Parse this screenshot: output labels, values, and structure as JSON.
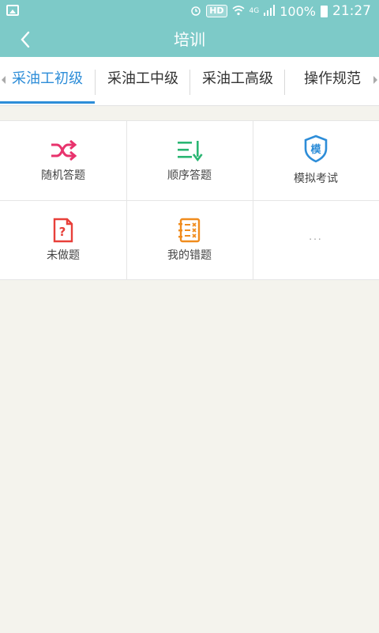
{
  "status_bar": {
    "network_badge": "HD",
    "network_type": "4G",
    "battery": "100%",
    "time": "21:27"
  },
  "header": {
    "title": "培训",
    "back_icon": "chevron-left-icon"
  },
  "tabs": [
    {
      "label": "采油工初级",
      "active": true
    },
    {
      "label": "采油工中级",
      "active": false
    },
    {
      "label": "采油工高级",
      "active": false
    },
    {
      "label": "操作规范",
      "active": false
    }
  ],
  "grid": {
    "items": [
      {
        "label": "随机答题",
        "icon": "shuffle-icon",
        "color": "#e8336d"
      },
      {
        "label": "顺序答题",
        "icon": "sort-list-icon",
        "color": "#2bb673"
      },
      {
        "label": "模拟考试",
        "icon": "shield-mock-icon",
        "color": "#2d8dd8",
        "icon_text": "模"
      },
      {
        "label": "未做题",
        "icon": "question-doc-icon",
        "color": "#e8403a",
        "icon_text": "?"
      },
      {
        "label": "我的错题",
        "icon": "wrong-notebook-icon",
        "color": "#f08c1e"
      },
      {
        "label": "",
        "icon": "more-icon",
        "more_text": "..."
      }
    ]
  },
  "colors": {
    "header_bg": "#7dcac8",
    "tab_active": "#2d8dd8",
    "page_bg": "#f4f3ed"
  }
}
